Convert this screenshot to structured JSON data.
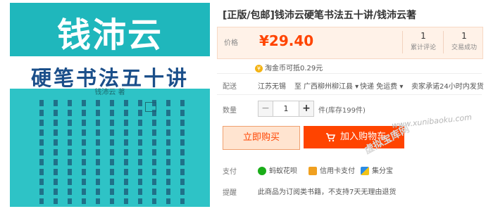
{
  "cover": {
    "author_big": "钱沛云",
    "book_title": "硬笔书法五十讲",
    "byline": "钱沛云  著"
  },
  "product": {
    "title": "[正版/包邮]钱沛云硬笔书法五十讲/钱沛云著",
    "price_label": "价格",
    "price": "¥29.40",
    "stats": [
      {
        "num": "1",
        "label": "累计评论"
      },
      {
        "num": "1",
        "label": "交易成功"
      }
    ],
    "coin_text": "淘金币可抵0.29元"
  },
  "shipping": {
    "label": "配送",
    "from": "江苏无锡",
    "to_word": "至",
    "to": "广西柳州柳江县",
    "method": "快递 免运费",
    "promise": "卖家承诺24小时内发货"
  },
  "quantity": {
    "label": "数量",
    "minus": "−",
    "plus": "+",
    "value": "1",
    "stock": "件(库存199件)"
  },
  "actions": {
    "buy_now": "立即购买",
    "add_to_cart": "加入购物车"
  },
  "payment": {
    "label": "支付",
    "methods": [
      "蚂蚁花呗",
      "信用卡支付",
      "集分宝"
    ]
  },
  "tip": {
    "label": "提醒",
    "text": "此商品为订阅类书籍，不支持7天无理由退货"
  },
  "watermark": "www.xunibaoku.com",
  "watermark2": "虚拟宝库网",
  "colors": {
    "accent": "#ff4400",
    "price_bg": "#fff2e8",
    "cover_teal": "#2ec3c6"
  }
}
